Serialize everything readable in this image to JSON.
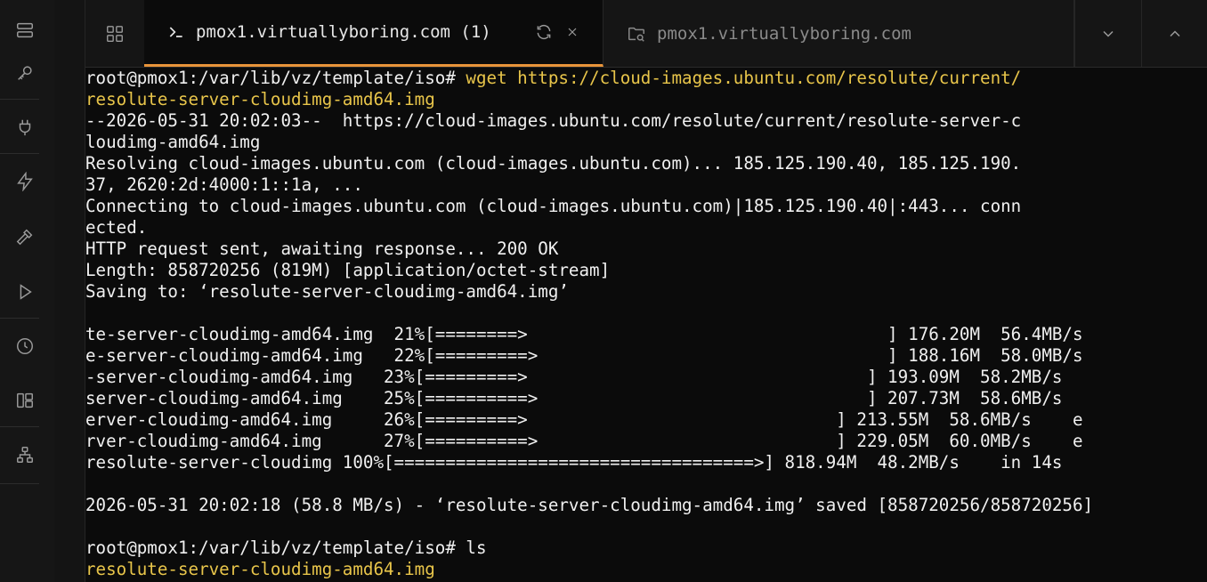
{
  "activity_bar": {
    "icons": [
      "server-list-icon",
      "key-icon",
      "plug-icon",
      "lightning-icon",
      "hammer-icon",
      "play-icon",
      "clock-icon",
      "panels-icon",
      "network-icon"
    ]
  },
  "tabs": {
    "active": {
      "prompt_glyph": ">_",
      "title": "pmox1.virtuallyboring.com (1)",
      "reconnect_glyph": "⟳",
      "close_glyph": "×"
    },
    "inactive": {
      "title": "pmox1.virtuallyboring.com"
    }
  },
  "colors": {
    "accent": "#e8943a",
    "highlight_text": "#e8c54a",
    "terminal_bg": "#0b0b0b",
    "terminal_text": "#f0f0f0"
  },
  "terminal": {
    "lines": [
      {
        "segments": [
          {
            "text": "root@pmox1:/var/lib/vz/template/iso# ",
            "style": "normal"
          },
          {
            "text": "wget https://cloud-images.ubuntu.com/resolute/current/",
            "style": "yellow"
          }
        ]
      },
      {
        "segments": [
          {
            "text": "resolute-server-cloudimg-amd64.img",
            "style": "yellow"
          }
        ]
      },
      {
        "segments": [
          {
            "text": "--2026-05-31 20:02:03--  https://cloud-images.ubuntu.com/resolute/current/resolute-server-c",
            "style": "normal"
          }
        ]
      },
      {
        "segments": [
          {
            "text": "loudimg-amd64.img",
            "style": "normal"
          }
        ]
      },
      {
        "segments": [
          {
            "text": "Resolving cloud-images.ubuntu.com (cloud-images.ubuntu.com)... 185.125.190.40, 185.125.190.",
            "style": "normal"
          }
        ]
      },
      {
        "segments": [
          {
            "text": "37, 2620:2d:4000:1::1a, ...",
            "style": "normal"
          }
        ]
      },
      {
        "segments": [
          {
            "text": "Connecting to cloud-images.ubuntu.com (cloud-images.ubuntu.com)|185.125.190.40|:443... conn",
            "style": "normal"
          }
        ]
      },
      {
        "segments": [
          {
            "text": "ected.",
            "style": "normal"
          }
        ]
      },
      {
        "segments": [
          {
            "text": "HTTP request sent, awaiting response... 200 OK",
            "style": "normal"
          }
        ]
      },
      {
        "segments": [
          {
            "text": "Length: 858720256 (819M) [application/octet-stream]",
            "style": "normal"
          }
        ]
      },
      {
        "segments": [
          {
            "text": "Saving to: ‘resolute-server-cloudimg-amd64.img’",
            "style": "normal"
          }
        ]
      },
      {
        "segments": [
          {
            "text": "",
            "style": "normal"
          }
        ]
      },
      {
        "segments": [
          {
            "text": "te-server-cloudimg-amd64.img  21%[========>                                   ] 176.20M  56.4MB/s",
            "style": "normal"
          }
        ]
      },
      {
        "segments": [
          {
            "text": "e-server-cloudimg-amd64.img   22%[=========>                                  ] 188.16M  58.0MB/s",
            "style": "normal"
          }
        ]
      },
      {
        "segments": [
          {
            "text": "-server-cloudimg-amd64.img   23%[=========>                                 ] 193.09M  58.2MB/s",
            "style": "normal"
          }
        ]
      },
      {
        "segments": [
          {
            "text": "server-cloudimg-amd64.img    25%[==========>                                ] 207.73M  58.6MB/s",
            "style": "normal"
          }
        ]
      },
      {
        "segments": [
          {
            "text": "erver-cloudimg-amd64.img     26%[=========>                              ] 213.55M  58.6MB/s    e",
            "style": "normal"
          }
        ]
      },
      {
        "segments": [
          {
            "text": "rver-cloudimg-amd64.img      27%[==========>                             ] 229.05M  60.0MB/s    e",
            "style": "normal"
          }
        ]
      },
      {
        "segments": [
          {
            "text": "resolute-server-cloudimg 100%[===================================>] 818.94M  48.2MB/s    in 14s",
            "style": "normal"
          }
        ]
      },
      {
        "segments": [
          {
            "text": "",
            "style": "normal"
          }
        ]
      },
      {
        "segments": [
          {
            "text": "2026-05-31 20:02:18 (58.8 MB/s) - ‘resolute-server-cloudimg-amd64.img’ saved [858720256/858720256]",
            "style": "normal"
          }
        ]
      },
      {
        "segments": [
          {
            "text": "",
            "style": "normal"
          }
        ]
      },
      {
        "segments": [
          {
            "text": "root@pmox1:/var/lib/vz/template/iso# ls",
            "style": "normal"
          }
        ]
      },
      {
        "segments": [
          {
            "text": "resolute-server-cloudimg-amd64.img",
            "style": "yellow"
          }
        ]
      }
    ]
  }
}
